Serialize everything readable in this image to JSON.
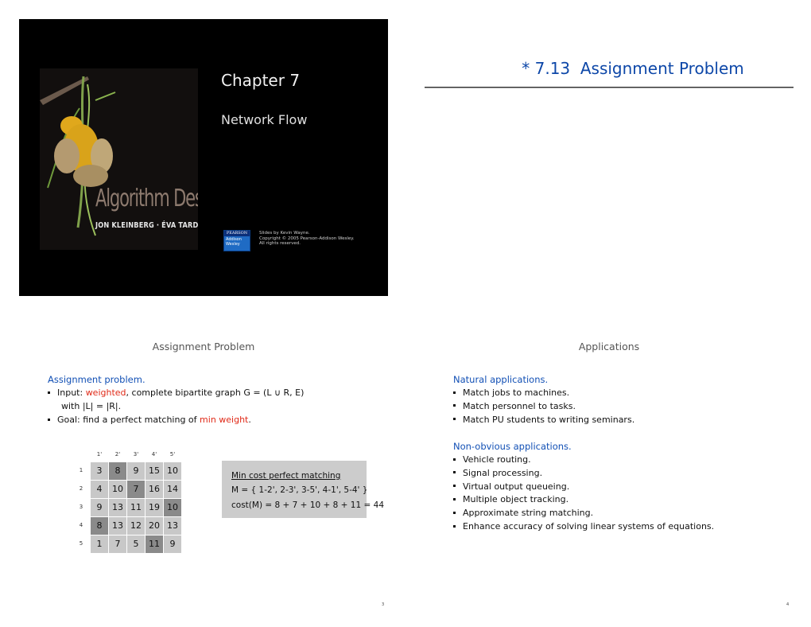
{
  "slides": {
    "cover": {
      "book_title": "Algorithm Design",
      "book_authors": "JON KLEINBERG · ÉVA TARDOS",
      "chapter_title": "Chapter 7",
      "chapter_subtitle": "Network Flow",
      "logo_top": "PEARSON",
      "logo_bottom": "Addison Wesley",
      "credits": "Slides by Kevin Wayne.\nCopyright © 2005 Pearson-Addison Wesley.\nAll rights reserved."
    },
    "section": {
      "title": "* 7.13  Assignment Problem"
    },
    "assignment": {
      "heading": "Assignment Problem",
      "intro": "Assignment problem.",
      "bullets": [
        {
          "pre": "Input:  ",
          "red": "weighted",
          "post": ", complete bipartite graph G = (L ∪ R, E)"
        },
        {
          "pre": "with |L| = |R|."
        },
        {
          "pre": "Goal:  find a perfect matching of ",
          "red": "min weight",
          "post": "."
        }
      ],
      "col_labels": [
        "1'",
        "2'",
        "3'",
        "4'",
        "5'"
      ],
      "row_labels": [
        "1",
        "2",
        "3",
        "4",
        "5"
      ],
      "matrix": [
        [
          3,
          8,
          9,
          15,
          10
        ],
        [
          4,
          10,
          7,
          16,
          14
        ],
        [
          9,
          13,
          11,
          19,
          10
        ],
        [
          8,
          13,
          12,
          20,
          13
        ],
        [
          1,
          7,
          5,
          11,
          9
        ]
      ],
      "selected": [
        [
          0,
          1
        ],
        [
          1,
          2
        ],
        [
          2,
          4
        ],
        [
          3,
          0
        ],
        [
          4,
          3
        ]
      ],
      "matching_title": "Min cost perfect matching",
      "matching_set": "M = { 1-2', 2-3', 3-5', 4-1', 5-4' }",
      "matching_cost": "cost(M) = 8 + 7 + 10 + 8 + 11 = 44",
      "page": "3"
    },
    "applications": {
      "heading": "Applications",
      "natural_head": "Natural applications.",
      "natural": [
        "Match jobs to machines.",
        "Match personnel to tasks.",
        "Match PU students to writing seminars."
      ],
      "nonobvious_head": "Non-obvious applications.",
      "nonobvious": [
        "Vehicle routing.",
        "Signal processing.",
        "Virtual output queueing.",
        "Multiple object tracking.",
        "Approximate string matching.",
        "Enhance accuracy of solving linear systems of equations."
      ],
      "page": "4"
    }
  },
  "colors": {
    "title_blue": "#0d47a8",
    "head_blue": "#1250b5",
    "emphasis_red": "#e02a18",
    "cell_gray": "#c8c8c8",
    "cell_selected": "#8a8a8a"
  }
}
